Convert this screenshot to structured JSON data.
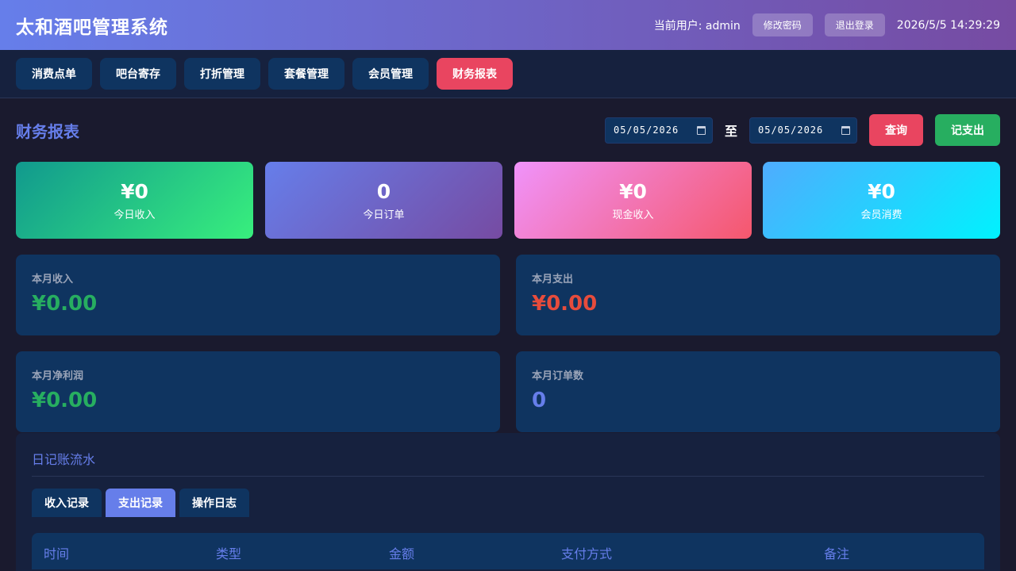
{
  "header": {
    "title": "太和酒吧管理系统",
    "user_label": "当前用户: admin",
    "change_password_label": "修改密码",
    "logout_label": "退出登录",
    "datetime": "2026/5/5 14:29:29"
  },
  "nav": {
    "items": [
      {
        "label": "消费点单"
      },
      {
        "label": "吧台寄存"
      },
      {
        "label": "打折管理"
      },
      {
        "label": "套餐管理"
      },
      {
        "label": "会员管理"
      },
      {
        "label": "财务报表",
        "active": true
      }
    ]
  },
  "report": {
    "title": "财务报表",
    "start_date": "05/05/2026",
    "separator": "至",
    "end_date": "05/05/2026",
    "query_label": "查询",
    "record_expense_label": "记支出"
  },
  "stats": [
    {
      "value": "¥0",
      "label": "今日收入"
    },
    {
      "value": "0",
      "label": "今日订单"
    },
    {
      "value": "¥0",
      "label": "现金收入"
    },
    {
      "value": "¥0",
      "label": "会员消费"
    }
  ],
  "summary": [
    {
      "label": "本月收入",
      "value": "¥0.00",
      "color": "#27ae60"
    },
    {
      "label": "本月支出",
      "value": "¥0.00",
      "color": "#e74c3c"
    },
    {
      "label": "本月净利润",
      "value": "¥0.00",
      "color": "#27ae60"
    },
    {
      "label": "本月订单数",
      "value": "0",
      "color": "#667eea"
    }
  ],
  "ledger": {
    "title": "日记账流水",
    "tabs": [
      {
        "label": "收入记录"
      },
      {
        "label": "支出记录",
        "active": true
      },
      {
        "label": "操作日志"
      }
    ],
    "columns": [
      "时间",
      "类型",
      "金额",
      "支付方式",
      "备注"
    ]
  },
  "colors": {
    "accent": "#667eea",
    "danger": "#e94560",
    "success": "#27ae60",
    "panel": "#0f3460",
    "background": "#1a1a2e"
  },
  "icons": {
    "date_picker": "calendar-icon"
  }
}
